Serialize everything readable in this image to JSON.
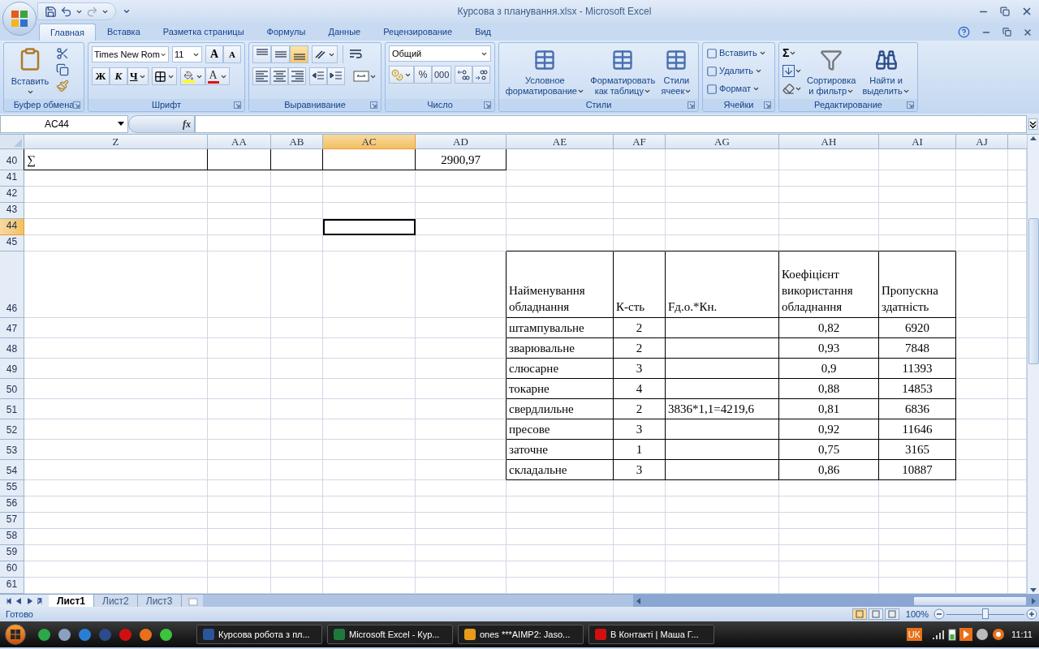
{
  "window": {
    "title": "Курсова з планування.xlsx - Microsoft Excel"
  },
  "ribbon_tabs": [
    {
      "label": "Главная",
      "selected": true
    },
    {
      "label": "Вставка",
      "selected": false
    },
    {
      "label": "Разметка страницы",
      "selected": false
    },
    {
      "label": "Формулы",
      "selected": false
    },
    {
      "label": "Данные",
      "selected": false
    },
    {
      "label": "Рецензирование",
      "selected": false
    },
    {
      "label": "Вид",
      "selected": false
    }
  ],
  "ribbon": {
    "clipboard": {
      "title": "Буфер обмена",
      "paste": "Вставить"
    },
    "font": {
      "title": "Шрифт",
      "font_name": "Times New Rom",
      "font_size": "11",
      "grow": "A",
      "shrink": "A",
      "bold": "Ж",
      "italic": "К",
      "underline": "Ч",
      "color_letter": "A"
    },
    "alignment": {
      "title": "Выравнивание",
      "vertical": [
        {
          "selected": false
        },
        {
          "selected": false
        },
        {
          "selected": true
        }
      ]
    },
    "number": {
      "title": "Число",
      "format": "Общий",
      "percent": "%",
      "thousands": "000"
    },
    "styles": {
      "title": "Стили",
      "buttons": [
        {
          "lines": [
            "Условное",
            "форматирование"
          ]
        },
        {
          "lines": [
            "Форматировать",
            "как таблицу"
          ]
        },
        {
          "lines": [
            "Стили",
            "ячеек"
          ]
        }
      ]
    },
    "cells": {
      "title": "Ячейки",
      "buttons": [
        "Вставить",
        "Удалить",
        "Формат"
      ]
    },
    "editing": {
      "title": "Редактирование",
      "sum": "Σ",
      "buttons": [
        {
          "lines": [
            "Сортировка",
            "и фильтр"
          ]
        },
        {
          "lines": [
            "Найти и",
            "выделить"
          ]
        }
      ]
    }
  },
  "formula_bar": {
    "name_box": "AC44",
    "fx": "fx"
  },
  "columns": [
    {
      "label": "Z",
      "selected": false
    },
    {
      "label": "AA",
      "selected": false
    },
    {
      "label": "AB",
      "selected": false
    },
    {
      "label": "AC",
      "selected": true
    },
    {
      "label": "AD",
      "selected": false
    },
    {
      "label": "AE",
      "selected": false
    },
    {
      "label": "AF",
      "selected": false
    },
    {
      "label": "AG",
      "selected": false
    },
    {
      "label": "AH",
      "selected": false
    },
    {
      "label": "AI",
      "selected": false
    },
    {
      "label": "AJ",
      "selected": false
    }
  ],
  "rows": [
    {
      "label": "40",
      "selected": false
    },
    {
      "label": "41",
      "selected": false
    },
    {
      "label": "42",
      "selected": false
    },
    {
      "label": "43",
      "selected": false
    },
    {
      "label": "44",
      "selected": true
    },
    {
      "label": "45",
      "selected": false
    },
    {
      "label": "46",
      "selected": false
    },
    {
      "label": "47",
      "selected": false
    },
    {
      "label": "48",
      "selected": false
    },
    {
      "label": "49",
      "selected": false
    },
    {
      "label": "50",
      "selected": false
    },
    {
      "label": "51",
      "selected": false
    },
    {
      "label": "52",
      "selected": false
    },
    {
      "label": "53",
      "selected": false
    },
    {
      "label": "54",
      "selected": false
    },
    {
      "label": "55",
      "selected": false
    },
    {
      "label": "56",
      "selected": false
    },
    {
      "label": "57",
      "selected": false
    },
    {
      "label": "58",
      "selected": false
    },
    {
      "label": "59",
      "selected": false
    },
    {
      "label": "60",
      "selected": false
    },
    {
      "label": "61",
      "selected": false
    }
  ],
  "sum_row": {
    "label": "∑",
    "total": "2900,97"
  },
  "table": {
    "columns": [
      "Найменування обладнання",
      "К-сть",
      "Fд.о.*Кн.",
      "Коефіцієнт використання обладнання",
      "Пропускна здатність"
    ],
    "rows": [
      {
        "name": "штампувальне",
        "count": "2",
        "coef": "0,82",
        "capacity": "6920"
      },
      {
        "name": "зварювальне",
        "count": "2",
        "coef": "0,93",
        "capacity": "7848"
      },
      {
        "name": "слюсарне",
        "count": "3",
        "coef": "0,9",
        "capacity": "11393"
      },
      {
        "name": "токарне",
        "count": "4",
        "coef": "0,88",
        "capacity": "14853"
      },
      {
        "name": "свердлильне",
        "count": "2",
        "formula": "3836*1,1=4219,6",
        "coef": "0,81",
        "capacity": "6836"
      },
      {
        "name": "пресове",
        "count": "3",
        "coef": "0,92",
        "capacity": "11646"
      },
      {
        "name": "заточне",
        "count": "1",
        "coef": "0,75",
        "capacity": "3165"
      },
      {
        "name": "складальне",
        "count": "3",
        "coef": "0,86",
        "capacity": "10887"
      }
    ]
  },
  "sheet_tabs": [
    {
      "label": "Лист1",
      "selected": true
    },
    {
      "label": "Лист2",
      "selected": false
    },
    {
      "label": "Лист3",
      "selected": false
    }
  ],
  "status_bar": {
    "text": "Готово",
    "zoom": "100%",
    "zoom_slider": {
      "level": 0.5
    }
  },
  "taskbar": {
    "tasks": [
      "Курсова робота з пл...",
      "Microsoft Excel - Кур...",
      "ones ***AIMP2: Jaso...",
      "В Контакті | Маша Г..."
    ],
    "language": "UK",
    "clock": "11:11"
  }
}
